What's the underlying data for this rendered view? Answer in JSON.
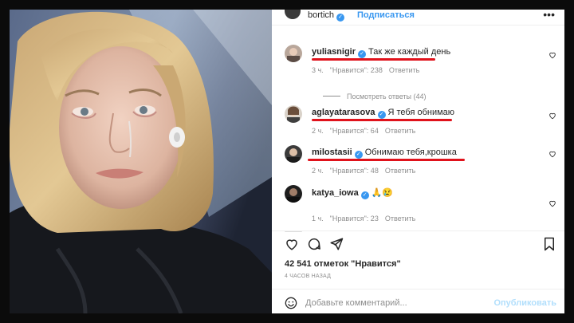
{
  "post": {
    "username": "bortich",
    "follow_label": "Подписаться",
    "more_label": "•••",
    "likes_text": "42 541 отметок \"Нравится\"",
    "time_ago": "4 ЧАСОВ НАЗАД"
  },
  "comments": [
    {
      "username": "yuliasnigir",
      "text": "Так же каждый день",
      "time": "3 ч.",
      "likes": "\"Нравится\": 238",
      "reply": "Ответить",
      "verified": true
    },
    {
      "username": "aglayatarasova",
      "text": "Я тебя обнимаю",
      "time": "2 ч.",
      "likes": "\"Нравится\": 64",
      "reply": "Ответить",
      "verified": true
    },
    {
      "username": "milostasii",
      "text": "Обнимаю тебя,крошка",
      "time": "2 ч.",
      "likes": "\"Нравится\": 48",
      "reply": "Ответить",
      "verified": true
    },
    {
      "username": "katya_iowa",
      "text": "🙏😢",
      "time": "1 ч.",
      "likes": "\"Нравится\": 23",
      "reply": "Ответить",
      "verified": true
    }
  ],
  "view_replies": "Посмотреть ответы (44)",
  "add_comment": {
    "placeholder": "Добавьте комментарий...",
    "post_label": "Опубликовать"
  },
  "icons": {
    "heart": "heart-icon",
    "comment": "comment-icon",
    "share": "share-icon",
    "bookmark": "bookmark-icon",
    "emoji": "emoji-icon",
    "more": "more-icon"
  },
  "colors": {
    "accent": "#3897f0",
    "highlight": "#e0121b",
    "muted": "#8e8e8e"
  }
}
